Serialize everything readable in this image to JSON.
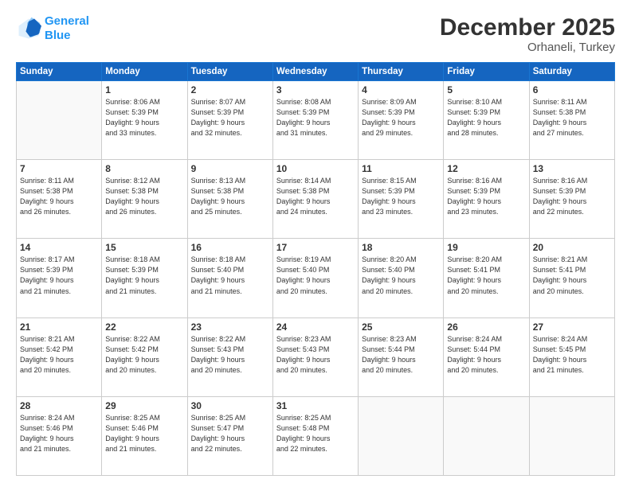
{
  "header": {
    "logo_line1": "General",
    "logo_line2": "Blue",
    "title": "December 2025",
    "subtitle": "Orhaneli, Turkey"
  },
  "days_of_week": [
    "Sunday",
    "Monday",
    "Tuesday",
    "Wednesday",
    "Thursday",
    "Friday",
    "Saturday"
  ],
  "weeks": [
    [
      {
        "day": "",
        "info": ""
      },
      {
        "day": "1",
        "info": "Sunrise: 8:06 AM\nSunset: 5:39 PM\nDaylight: 9 hours\nand 33 minutes."
      },
      {
        "day": "2",
        "info": "Sunrise: 8:07 AM\nSunset: 5:39 PM\nDaylight: 9 hours\nand 32 minutes."
      },
      {
        "day": "3",
        "info": "Sunrise: 8:08 AM\nSunset: 5:39 PM\nDaylight: 9 hours\nand 31 minutes."
      },
      {
        "day": "4",
        "info": "Sunrise: 8:09 AM\nSunset: 5:39 PM\nDaylight: 9 hours\nand 29 minutes."
      },
      {
        "day": "5",
        "info": "Sunrise: 8:10 AM\nSunset: 5:39 PM\nDaylight: 9 hours\nand 28 minutes."
      },
      {
        "day": "6",
        "info": "Sunrise: 8:11 AM\nSunset: 5:38 PM\nDaylight: 9 hours\nand 27 minutes."
      }
    ],
    [
      {
        "day": "7",
        "info": ""
      },
      {
        "day": "8",
        "info": "Sunrise: 8:12 AM\nSunset: 5:38 PM\nDaylight: 9 hours\nand 26 minutes."
      },
      {
        "day": "9",
        "info": "Sunrise: 8:13 AM\nSunset: 5:38 PM\nDaylight: 9 hours\nand 25 minutes."
      },
      {
        "day": "10",
        "info": "Sunrise: 8:14 AM\nSunset: 5:38 PM\nDaylight: 9 hours\nand 24 minutes."
      },
      {
        "day": "11",
        "info": "Sunrise: 8:15 AM\nSunset: 5:39 PM\nDaylight: 9 hours\nand 23 minutes."
      },
      {
        "day": "12",
        "info": "Sunrise: 8:16 AM\nSunset: 5:39 PM\nDaylight: 9 hours\nand 23 minutes."
      },
      {
        "day": "13",
        "info": "Sunrise: 8:16 AM\nSunset: 5:39 PM\nDaylight: 9 hours\nand 22 minutes."
      }
    ],
    [
      {
        "day": "14",
        "info": ""
      },
      {
        "day": "15",
        "info": "Sunrise: 8:18 AM\nSunset: 5:39 PM\nDaylight: 9 hours\nand 21 minutes."
      },
      {
        "day": "16",
        "info": "Sunrise: 8:18 AM\nSunset: 5:40 PM\nDaylight: 9 hours\nand 21 minutes."
      },
      {
        "day": "17",
        "info": "Sunrise: 8:19 AM\nSunset: 5:40 PM\nDaylight: 9 hours\nand 20 minutes."
      },
      {
        "day": "18",
        "info": "Sunrise: 8:20 AM\nSunset: 5:40 PM\nDaylight: 9 hours\nand 20 minutes."
      },
      {
        "day": "19",
        "info": "Sunrise: 8:20 AM\nSunset: 5:41 PM\nDaylight: 9 hours\nand 20 minutes."
      },
      {
        "day": "20",
        "info": "Sunrise: 8:21 AM\nSunset: 5:41 PM\nDaylight: 9 hours\nand 20 minutes."
      }
    ],
    [
      {
        "day": "21",
        "info": ""
      },
      {
        "day": "22",
        "info": "Sunrise: 8:22 AM\nSunset: 5:42 PM\nDaylight: 9 hours\nand 20 minutes."
      },
      {
        "day": "23",
        "info": "Sunrise: 8:22 AM\nSunset: 5:43 PM\nDaylight: 9 hours\nand 20 minutes."
      },
      {
        "day": "24",
        "info": "Sunrise: 8:23 AM\nSunset: 5:43 PM\nDaylight: 9 hours\nand 20 minutes."
      },
      {
        "day": "25",
        "info": "Sunrise: 8:23 AM\nSunset: 5:44 PM\nDaylight: 9 hours\nand 20 minutes."
      },
      {
        "day": "26",
        "info": "Sunrise: 8:24 AM\nSunset: 5:44 PM\nDaylight: 9 hours\nand 20 minutes."
      },
      {
        "day": "27",
        "info": "Sunrise: 8:24 AM\nSunset: 5:45 PM\nDaylight: 9 hours\nand 21 minutes."
      }
    ],
    [
      {
        "day": "28",
        "info": "Sunrise: 8:24 AM\nSunset: 5:46 PM\nDaylight: 9 hours\nand 21 minutes."
      },
      {
        "day": "29",
        "info": "Sunrise: 8:25 AM\nSunset: 5:46 PM\nDaylight: 9 hours\nand 21 minutes."
      },
      {
        "day": "30",
        "info": "Sunrise: 8:25 AM\nSunset: 5:47 PM\nDaylight: 9 hours\nand 22 minutes."
      },
      {
        "day": "31",
        "info": "Sunrise: 8:25 AM\nSunset: 5:48 PM\nDaylight: 9 hours\nand 22 minutes."
      },
      {
        "day": "",
        "info": ""
      },
      {
        "day": "",
        "info": ""
      },
      {
        "day": "",
        "info": ""
      }
    ]
  ],
  "week1_sunday_info": "Sunrise: 8:11 AM\nSunset: 5:38 PM\nDaylight: 9 hours\nand 26 minutes.",
  "week3_sunday_info": "Sunrise: 8:17 AM\nSunset: 5:39 PM\nDaylight: 9 hours\nand 21 minutes.",
  "week4_sunday_info": "Sunrise: 8:21 AM\nSunset: 5:42 PM\nDaylight: 9 hours\nand 20 minutes."
}
